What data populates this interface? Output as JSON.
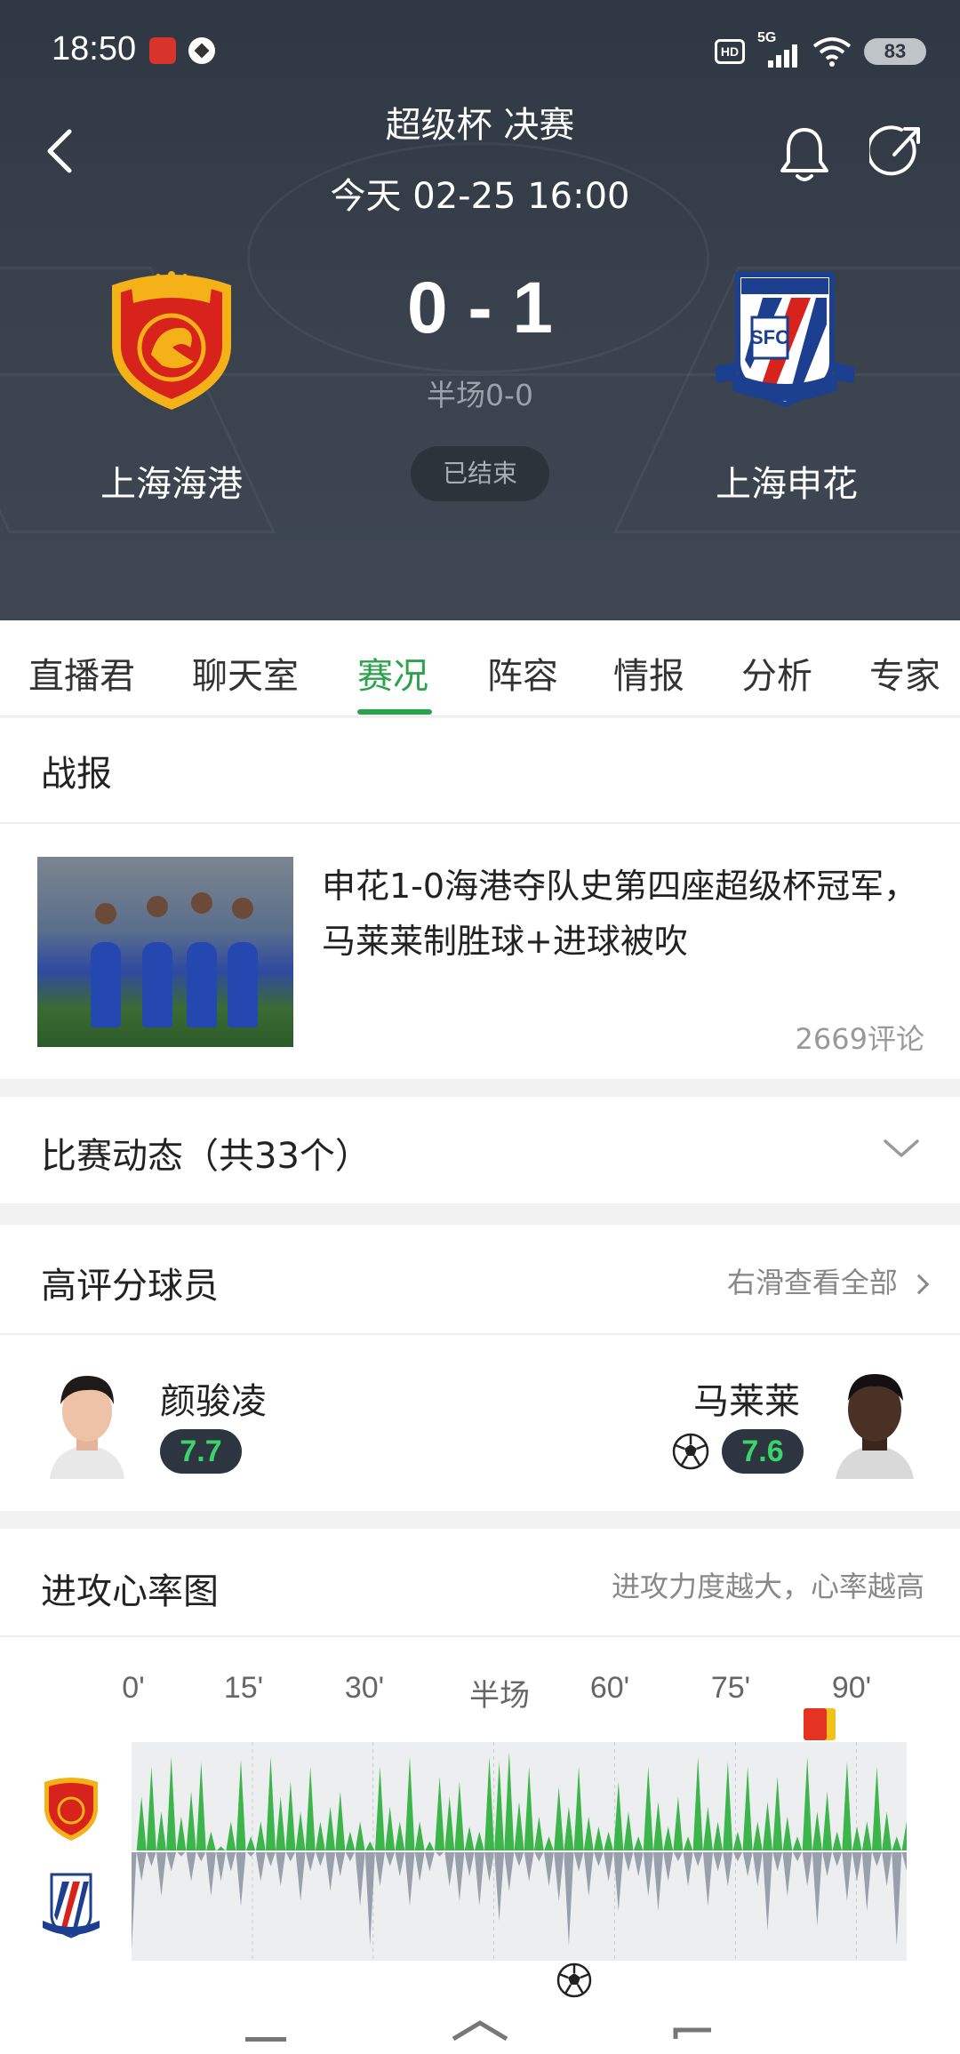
{
  "status_bar": {
    "time": "18:50",
    "hd_label": "HD",
    "network_label": "5G",
    "battery": "83",
    "icons": [
      "news-app-icon",
      "football-app-icon",
      "hd-icon",
      "signal-icon",
      "wifi-icon",
      "battery-icon"
    ]
  },
  "header": {
    "title": "超级杯 决赛",
    "datetime": "今天 02-25 16:00",
    "home_team": "上海海港",
    "away_team": "上海申花",
    "score": "0 - 1",
    "halftime": "半场0-0",
    "status": "已结束",
    "icons": [
      "back-icon",
      "bell-icon",
      "share-icon"
    ],
    "colors": {
      "background": "#353e48",
      "accent": "#2ba24c"
    }
  },
  "tabs": [
    "直播君",
    "聊天室",
    "赛况",
    "阵容",
    "情报",
    "分析",
    "专家"
  ],
  "active_tab": "赛况",
  "report": {
    "section_title": "战报",
    "news_title": "申花1-0海港夺队史第四座超级杯冠军，马莱莱制胜球+进球被吹",
    "comments": "2669评论"
  },
  "events": {
    "title": "比赛动态（共33个）"
  },
  "top_players": {
    "title": "高评分球员",
    "see_all": "右滑查看全部",
    "home": {
      "name": "颜骏凌",
      "rating": "7.7"
    },
    "away": {
      "name": "马莱莱",
      "rating": "7.6",
      "scored": true
    }
  },
  "heart_rate": {
    "title": "进攻心率图",
    "subtitle": "进攻力度越大，心率越高",
    "ticks": [
      "0'",
      "15'",
      "30'",
      "半场",
      "60'",
      "75'",
      "90'"
    ],
    "colors": {
      "home": "#3cb54a",
      "away": "#97a0ab",
      "background": "#eceef0"
    },
    "events": [
      {
        "type": "red-card",
        "minute": 90
      },
      {
        "type": "goal",
        "team": "away",
        "minute": 55
      }
    ]
  },
  "chart_data": {
    "type": "area",
    "title": "进攻心率图",
    "x_ticks": [
      "0'",
      "15'",
      "30'",
      "半场",
      "60'",
      "75'",
      "90'"
    ],
    "series": [
      {
        "values": [
          0,
          0.55,
          0.85,
          0.4,
          0.95,
          0.35,
          0.6,
          0.9,
          0.2,
          0.05,
          0.3,
          0.92,
          0.15,
          0.3,
          0.95,
          0.55,
          0.7,
          0.4,
          0.85,
          0.3,
          0.45,
          0.6,
          0.2,
          0.3,
          0.1,
          0.85,
          0.45,
          0.3,
          0.95,
          0.3,
          0.1,
          0.75,
          0.55,
          0.7,
          0.25,
          0.2,
          0.95,
          0.9,
          1,
          0.5,
          0.85,
          0.35,
          0.15,
          0.65,
          0.45,
          0.85,
          0.35,
          0.25,
          0.2,
          0.7,
          0.4,
          0.15,
          0.85,
          0.5,
          0.25,
          0.55,
          0.15,
          0.95,
          0.45,
          0.3,
          0.9,
          0.2,
          0.85,
          0.3,
          0.5,
          0.75,
          0.35,
          0.15,
          0.95,
          0.4,
          0.6,
          0.2,
          0.9,
          0.25,
          0.3,
          0.85,
          0.4,
          0.15,
          0.3
        ]
      },
      {
        "values": [
          1,
          0.3,
          0.15,
          0.45,
          0.2,
          0.05,
          0.3,
          0.1,
          0.45,
          0.3,
          0.2,
          0.55,
          0.05,
          0.3,
          0.15,
          0.35,
          0.1,
          0.5,
          0.2,
          0.15,
          0.4,
          0.25,
          0.1,
          0.55,
          0.95,
          0.35,
          0.15,
          0.25,
          0.55,
          0.3,
          0.2,
          0.05,
          0.35,
          0.5,
          0.25,
          0.55,
          0.3,
          0.7,
          0.4,
          0.15,
          0.3,
          0.1,
          0.35,
          0.5,
          0.95,
          0.2,
          0.45,
          0.15,
          0.3,
          0.6,
          0.2,
          0.25,
          0.45,
          0.6,
          0.3,
          0.1,
          0.35,
          0.15,
          0.55,
          0.2,
          0.35,
          0.1,
          0.25,
          0.35,
          0.8,
          0.2,
          0.45,
          0.1,
          0.35,
          0.75,
          0.25,
          0.15,
          0.5,
          0.3,
          0.6,
          0.15,
          0.35,
          0.95,
          0.2
        ]
      }
    ]
  }
}
